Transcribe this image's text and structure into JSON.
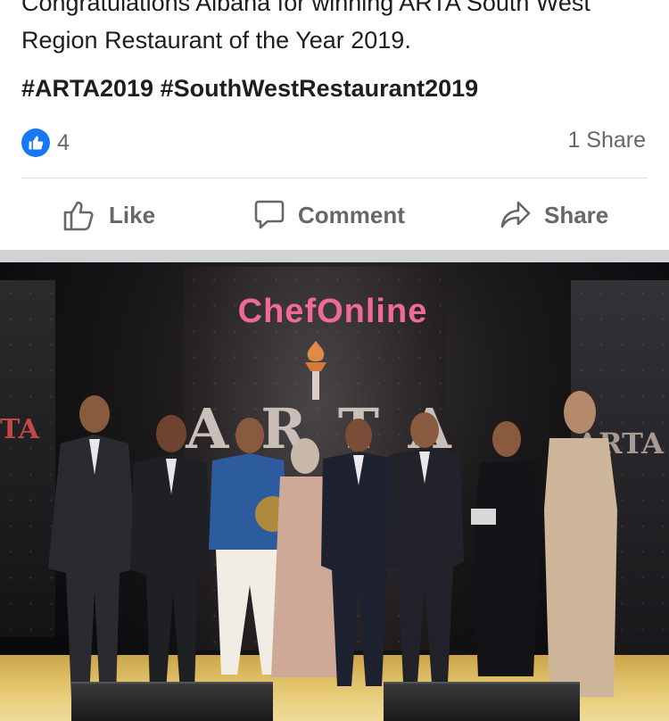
{
  "post": {
    "text_line1": "Congratulations Albana for winning ARTA South West",
    "text_line2": "Region Restaurant of the Year 2019.",
    "hashtags": "#ARTA2019 #SouthWestRestaurant2019",
    "reaction_count": "4",
    "share_count": "1 Share"
  },
  "actions": {
    "like_label": "Like",
    "comment_label": "Comment",
    "share_label": "Share"
  },
  "photo": {
    "brand_text": "ChefOnline",
    "event_logo_text": "ARTA",
    "side_logo_left": "TA",
    "side_logo_right": "ARTA"
  },
  "colors": {
    "like_blue": "#1877f2",
    "action_gray": "#65676b",
    "brand_pink": "#f06a96",
    "gold_floor": "#e3c46c"
  },
  "icons": {
    "reaction": "thumbs-up-icon",
    "like": "thumbs-up-outline-icon",
    "comment": "speech-bubble-icon",
    "share": "share-arrow-icon"
  }
}
